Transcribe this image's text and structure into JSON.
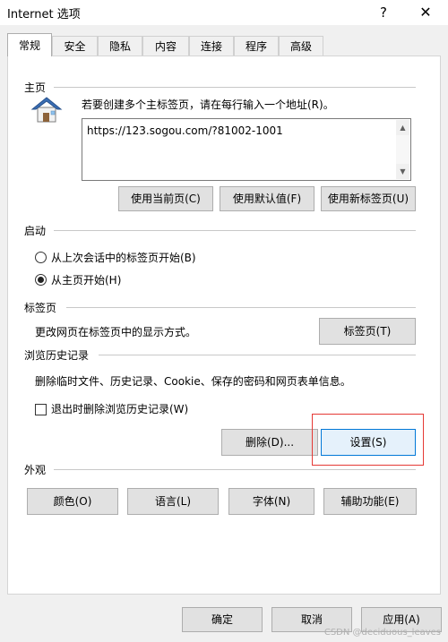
{
  "window": {
    "title": "Internet 选项",
    "help": "?",
    "close": "✕"
  },
  "tabs": [
    "常规",
    "安全",
    "隐私",
    "内容",
    "连接",
    "程序",
    "高级"
  ],
  "home": {
    "label": "主页",
    "icon": "house-icon",
    "instruction": "若要创建多个主标签页，请在每行输入一个地址(R)。",
    "url": "https://123.sogou.com/?81002-1001",
    "buttons": [
      "使用当前页(C)",
      "使用默认值(F)",
      "使用新标签页(U)"
    ]
  },
  "startup": {
    "label": "启动",
    "option1": "从上次会话中的标签页开始(B)",
    "option2": "从主页开始(H)"
  },
  "tabs_section": {
    "label": "标签页",
    "desc": "更改网页在标签页中的显示方式。",
    "button": "标签页(T)"
  },
  "history": {
    "label": "浏览历史记录",
    "desc": "删除临时文件、历史记录、Cookie、保存的密码和网页表单信息。",
    "checkbox": "退出时删除浏览历史记录(W)",
    "delete_button": "删除(D)...",
    "settings_button": "设置(S)"
  },
  "appearance": {
    "label": "外观",
    "buttons": [
      "颜色(O)",
      "语言(L)",
      "字体(N)",
      "辅助功能(E)"
    ]
  },
  "footer": {
    "ok": "确定",
    "cancel": "取消",
    "apply": "应用(A)"
  },
  "watermark": "CSDN @deciduous_leaves",
  "colors": {
    "highlight_box": "#e53935",
    "focus_border": "#0078d7"
  }
}
